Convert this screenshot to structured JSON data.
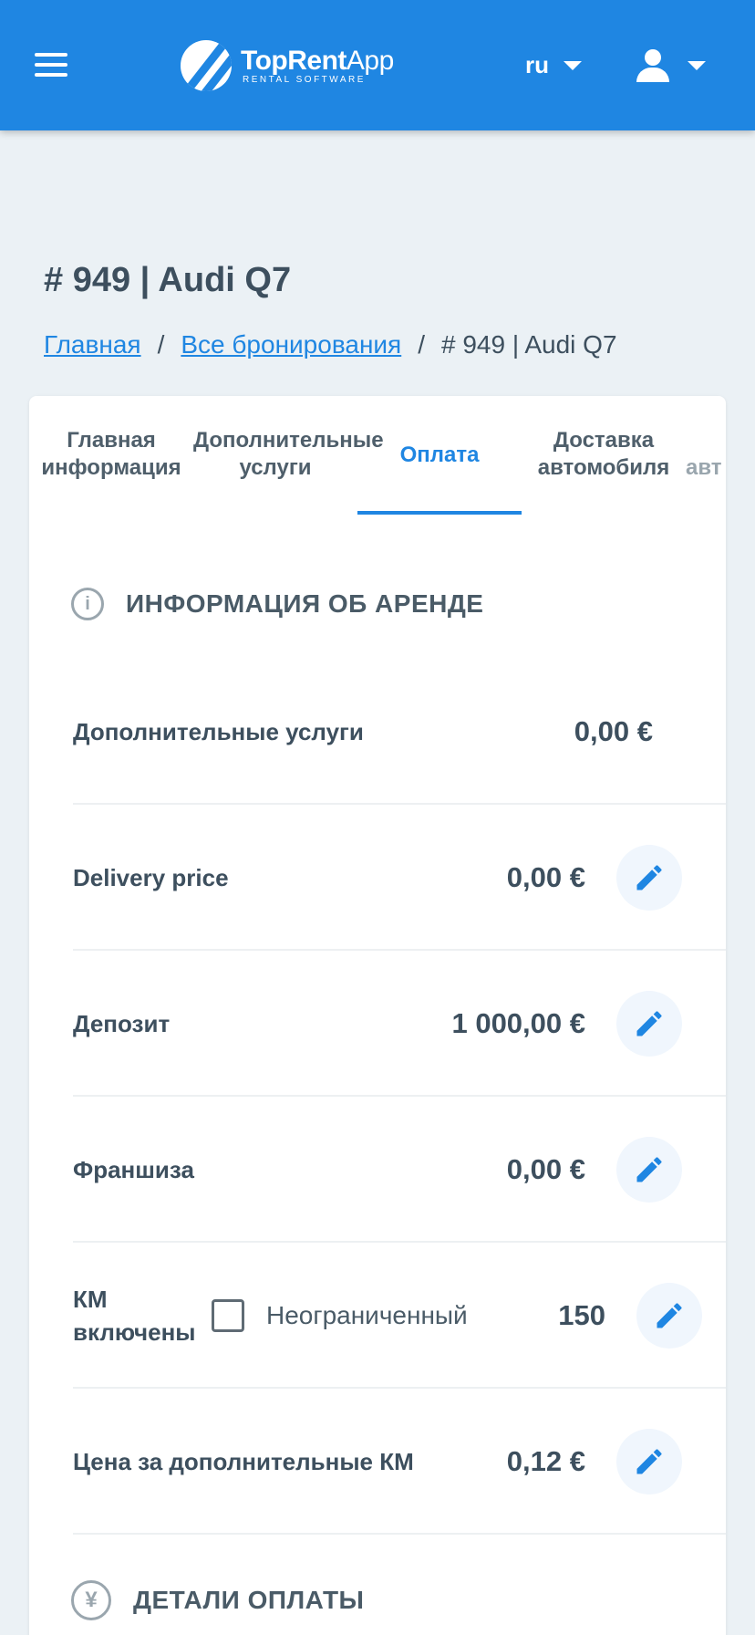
{
  "header": {
    "logo_title_bold": "TopRent",
    "logo_title_light": "App",
    "logo_subtitle": "RENTAL SOFTWARE",
    "language": "ru",
    "brand_color": "#1f86e2"
  },
  "page": {
    "title": "# 949 | Audi Q7",
    "breadcrumb": [
      {
        "label": "Главная"
      },
      {
        "label": "Все бронирования"
      },
      {
        "label": "# 949 | Audi Q7"
      }
    ]
  },
  "tabs": [
    {
      "line1": "Главная",
      "line2": "информация"
    },
    {
      "line1": "Дополнительные",
      "line2": "услуги"
    },
    {
      "line1": "Оплата",
      "line2": ""
    },
    {
      "line1": "Доставка",
      "line2": "автомобиля"
    },
    {
      "line1": "авт",
      "line2": ""
    }
  ],
  "active_tab": "Оплата",
  "rental_info": {
    "title": "ИНФОРМАЦИЯ ОБ АРЕНДЕ",
    "icon": "info-icon",
    "rows": [
      {
        "label": "Дополнительные услуги",
        "value": "0,00 €",
        "editable": false
      },
      {
        "label": "Delivery price",
        "value": "0,00 €",
        "editable": true
      },
      {
        "label": "Депозит",
        "value": "1 000,00 €",
        "editable": true
      },
      {
        "label": "Франшиза",
        "value": "0,00 €",
        "editable": true
      },
      {
        "label": "Цена за дополнительные КМ",
        "value": "0,12 €",
        "editable": true
      }
    ],
    "km": {
      "label_line1": "КМ",
      "label_line2": "включены",
      "checkbox_label": "Неограниченный",
      "checked": false,
      "value": "150"
    }
  },
  "payment_details": {
    "title": "ДЕТАЛИ ОПЛАТЫ",
    "icon": "yen-icon"
  }
}
